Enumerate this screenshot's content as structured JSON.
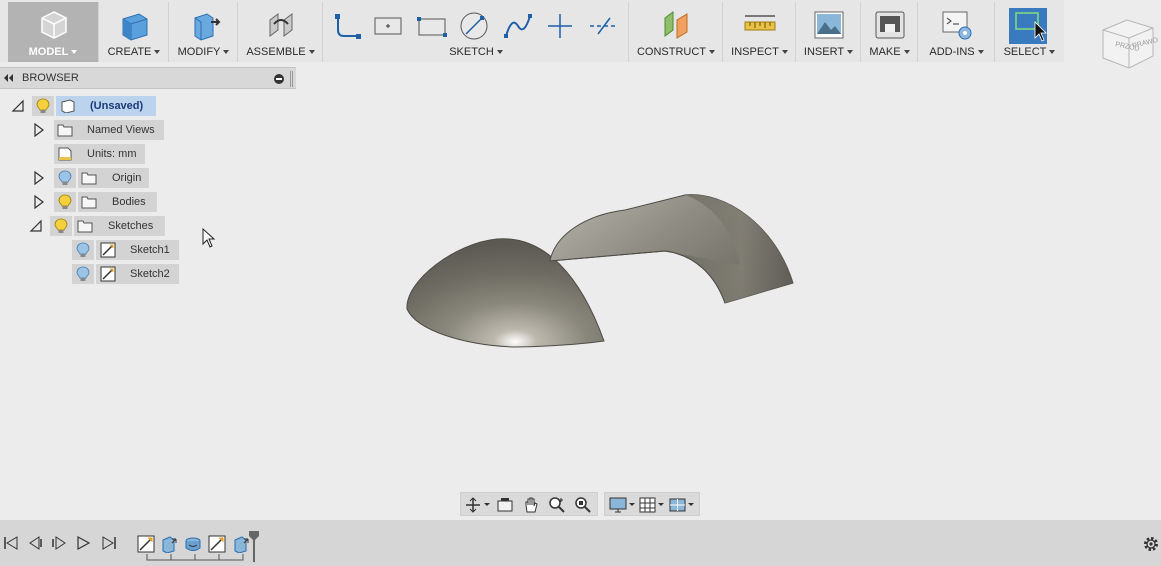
{
  "toolbar": {
    "model": "MODEL",
    "create": "CREATE",
    "modify": "MODIFY",
    "assemble": "ASSEMBLE",
    "sketch": "SKETCH",
    "construct": "CONSTRUCT",
    "inspect": "INSPECT",
    "insert": "INSERT",
    "make": "MAKE",
    "addins": "ADD-INS",
    "select": "SELECT"
  },
  "viewcube": {
    "face_front": "PRZÓD",
    "face_right": "PRAWO"
  },
  "browser": {
    "title": "BROWSER",
    "root": "(Unsaved)",
    "named_views": "Named Views",
    "units": "Units: mm",
    "origin": "Origin",
    "bodies": "Bodies",
    "sketches": "Sketches",
    "sketch1": "Sketch1",
    "sketch2": "Sketch2"
  },
  "colors": {
    "accent_select": "#3a7bbf",
    "selected_node": "#bcd3ee",
    "bulb_on": "#f4d03f",
    "bulb_off": "#9cc4e8"
  }
}
